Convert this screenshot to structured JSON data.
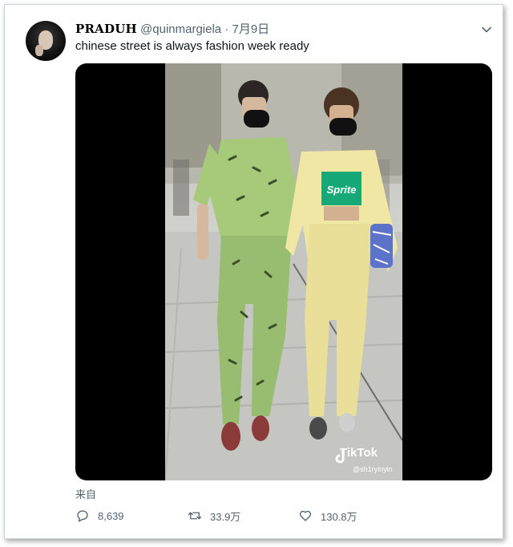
{
  "tweet": {
    "display_name": "PRADUH",
    "handle": "@quinmargiela",
    "separator": "·",
    "date": "7月9日",
    "text": "chinese street is always fashion week ready",
    "source_label": "来自"
  },
  "media": {
    "watermark": "TikTok",
    "watermark_user": "@sh1ryinyin",
    "shirt_text": "Sprite"
  },
  "actions": {
    "replies": "8,639",
    "retweets": "33.9万",
    "likes": "130.8万"
  },
  "colors": {
    "text_primary": "#0f1419",
    "text_secondary": "#536471",
    "green_outfit": "#a6c97a",
    "yellow_outfit": "#efe7a3"
  }
}
